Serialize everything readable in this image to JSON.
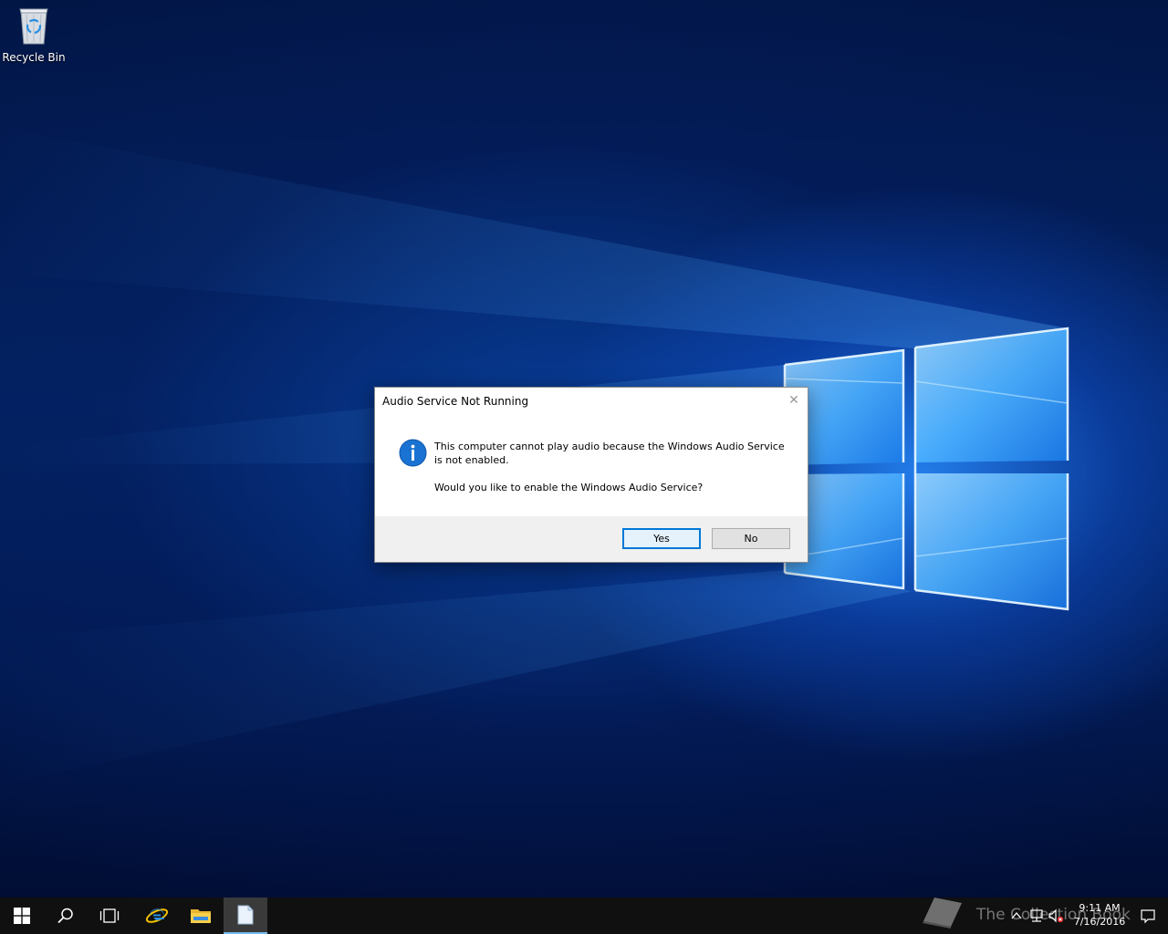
{
  "desktop": {
    "icons": [
      {
        "label": "Recycle Bin",
        "icon": "recycle-bin-icon"
      }
    ]
  },
  "dialog": {
    "title": "Audio Service Not Running",
    "icon": "info-icon",
    "message": "This computer cannot play audio because the Windows Audio Service is not enabled.",
    "question": "Would you like to enable the Windows Audio Service?",
    "buttons": {
      "yes": "Yes",
      "no": "No"
    }
  },
  "taskbar": {
    "items": [
      {
        "name": "start",
        "icon": "windows-logo-icon"
      },
      {
        "name": "search",
        "icon": "search-icon"
      },
      {
        "name": "task-view",
        "icon": "task-view-icon"
      },
      {
        "name": "internet-explorer",
        "icon": "internet-explorer-icon"
      },
      {
        "name": "file-explorer",
        "icon": "folder-icon"
      },
      {
        "name": "document",
        "icon": "document-icon",
        "active": true
      }
    ],
    "tray": {
      "time": "9:11 AM",
      "date": "7/16/2016",
      "icons": [
        "chevron-up-icon",
        "network-icon",
        "speaker-muted-icon",
        "notification-icon"
      ]
    },
    "watermark": "The Collection Book"
  },
  "colors": {
    "accent": "#0078d7",
    "taskbar": "#101010",
    "dialog_footer": "#f0f0f0"
  }
}
